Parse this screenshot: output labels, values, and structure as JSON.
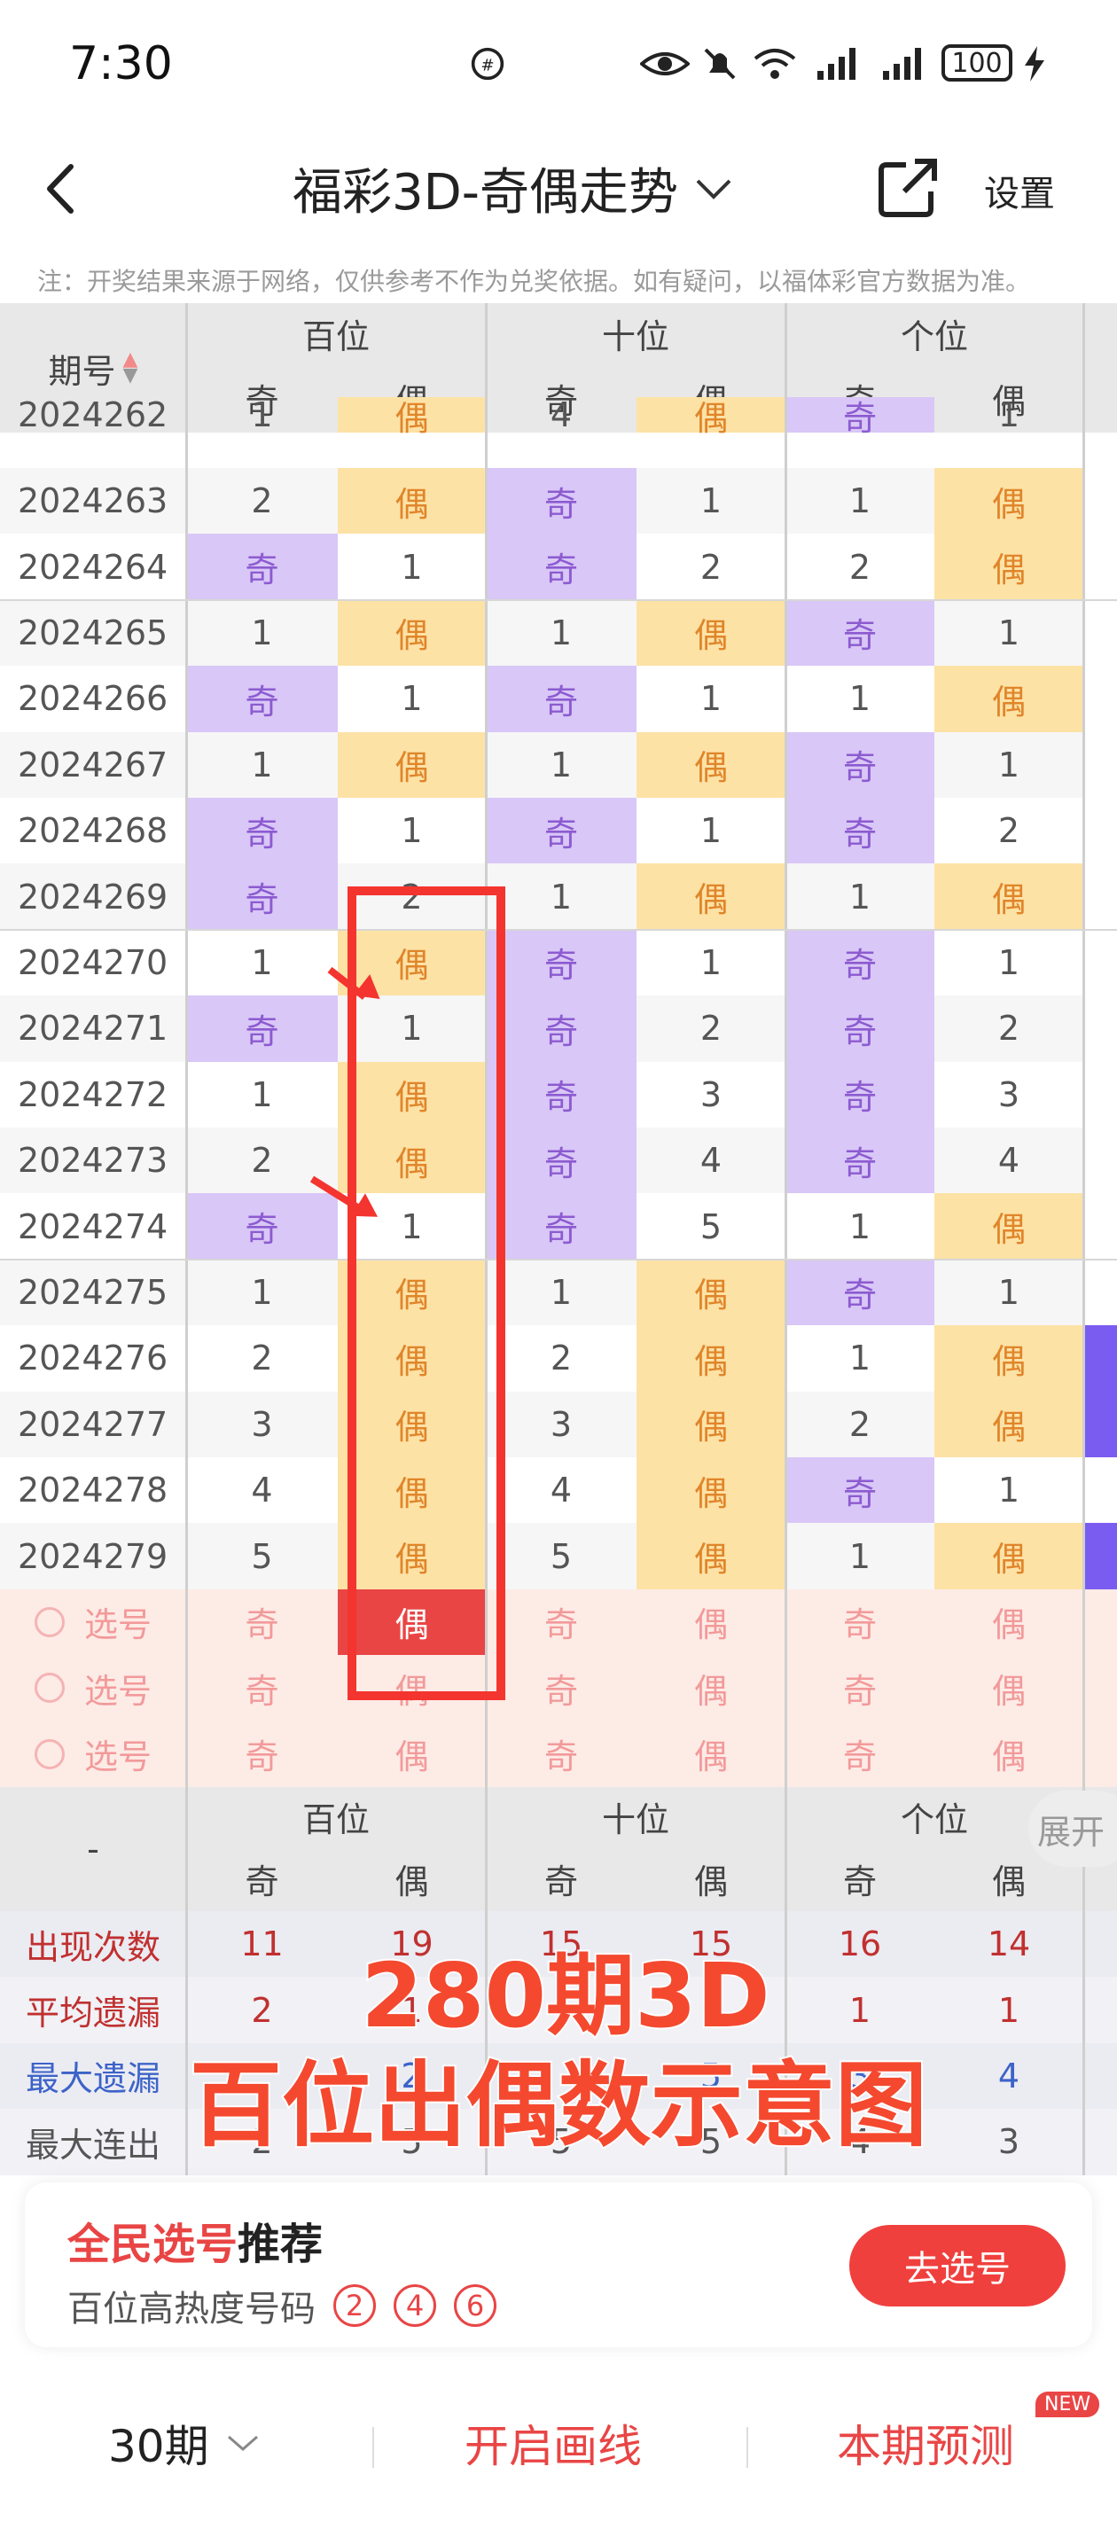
{
  "status_bar": {
    "time": "7:30",
    "battery": "100"
  },
  "header": {
    "title": "福彩3D-奇偶走势",
    "settings": "设置"
  },
  "note": "注：开奖结果来源于网络，仅供参考不作为兑奖依据。如有疑问，以福体彩官方数据为准。",
  "table": {
    "issue_header": "期号",
    "groups": [
      "百位",
      "十位",
      "个位"
    ],
    "sub": [
      "奇",
      "偶"
    ],
    "partial_row": {
      "issue": "2024262",
      "cells": [
        "1",
        "偶",
        "4",
        "偶",
        "奇",
        "1"
      ]
    },
    "rows": [
      {
        "issue": "2024263",
        "cells": [
          "2",
          "偶",
          "奇",
          "1",
          "1",
          "偶"
        ]
      },
      {
        "issue": "2024264",
        "cells": [
          "奇",
          "1",
          "奇",
          "2",
          "2",
          "偶"
        ]
      },
      {
        "issue": "2024265",
        "cells": [
          "1",
          "偶",
          "1",
          "偶",
          "奇",
          "1"
        ]
      },
      {
        "issue": "2024266",
        "cells": [
          "奇",
          "1",
          "奇",
          "1",
          "1",
          "偶"
        ]
      },
      {
        "issue": "2024267",
        "cells": [
          "1",
          "偶",
          "1",
          "偶",
          "奇",
          "1"
        ]
      },
      {
        "issue": "2024268",
        "cells": [
          "奇",
          "1",
          "奇",
          "1",
          "奇",
          "2"
        ]
      },
      {
        "issue": "2024269",
        "cells": [
          "奇",
          "2",
          "1",
          "偶",
          "1",
          "偶"
        ]
      },
      {
        "issue": "2024270",
        "cells": [
          "1",
          "偶",
          "奇",
          "1",
          "奇",
          "1"
        ]
      },
      {
        "issue": "2024271",
        "cells": [
          "奇",
          "1",
          "奇",
          "2",
          "奇",
          "2"
        ]
      },
      {
        "issue": "2024272",
        "cells": [
          "1",
          "偶",
          "奇",
          "3",
          "奇",
          "3"
        ]
      },
      {
        "issue": "2024273",
        "cells": [
          "2",
          "偶",
          "奇",
          "4",
          "奇",
          "4"
        ]
      },
      {
        "issue": "2024274",
        "cells": [
          "奇",
          "1",
          "奇",
          "5",
          "1",
          "偶"
        ]
      },
      {
        "issue": "2024275",
        "cells": [
          "1",
          "偶",
          "1",
          "偶",
          "奇",
          "1"
        ]
      },
      {
        "issue": "2024276",
        "cells": [
          "2",
          "偶",
          "2",
          "偶",
          "1",
          "偶"
        ]
      },
      {
        "issue": "2024277",
        "cells": [
          "3",
          "偶",
          "3",
          "偶",
          "2",
          "偶"
        ]
      },
      {
        "issue": "2024278",
        "cells": [
          "4",
          "偶",
          "4",
          "偶",
          "奇",
          "1"
        ]
      },
      {
        "issue": "2024279",
        "cells": [
          "5",
          "偶",
          "5",
          "偶",
          "1",
          "偶"
        ]
      }
    ],
    "pick_label": "选号",
    "pick_rows": 3,
    "selected_pick": {
      "row": 0,
      "col": 1
    },
    "stats_header_label": "-",
    "stats": [
      {
        "label": "出现次数",
        "color": "#c0302f",
        "values": [
          "11",
          "19",
          "15",
          "15",
          "16",
          "14"
        ]
      },
      {
        "label": "平均遗漏",
        "color": "#c0302f",
        "values": [
          "2",
          "1",
          "",
          "",
          "1",
          "1"
        ]
      },
      {
        "label": "最大遗漏",
        "color": "#3c63c8",
        "values": [
          "",
          "2",
          "",
          "5",
          "3",
          "4"
        ]
      },
      {
        "label": "最大连出",
        "color": "#555555",
        "values": [
          "2",
          "5",
          "5",
          "5",
          "4",
          "3"
        ]
      }
    ],
    "expand": "展开"
  },
  "annotation": {
    "line1": "280期3D",
    "line2": "百位出偶数示意图"
  },
  "recommend": {
    "title_red": "全民选号",
    "title_black": "推荐",
    "subtitle": "百位高热度号码",
    "balls": [
      "2",
      "4",
      "6"
    ],
    "button": "去选号"
  },
  "tabbar": {
    "period": "30期",
    "draw": "开启画线",
    "predict": "本期预测",
    "new_badge": "NEW"
  },
  "colors": {
    "odd_bg": "#d9c7f7",
    "even_bg": "#fde2a6",
    "accent": "#e94545"
  }
}
